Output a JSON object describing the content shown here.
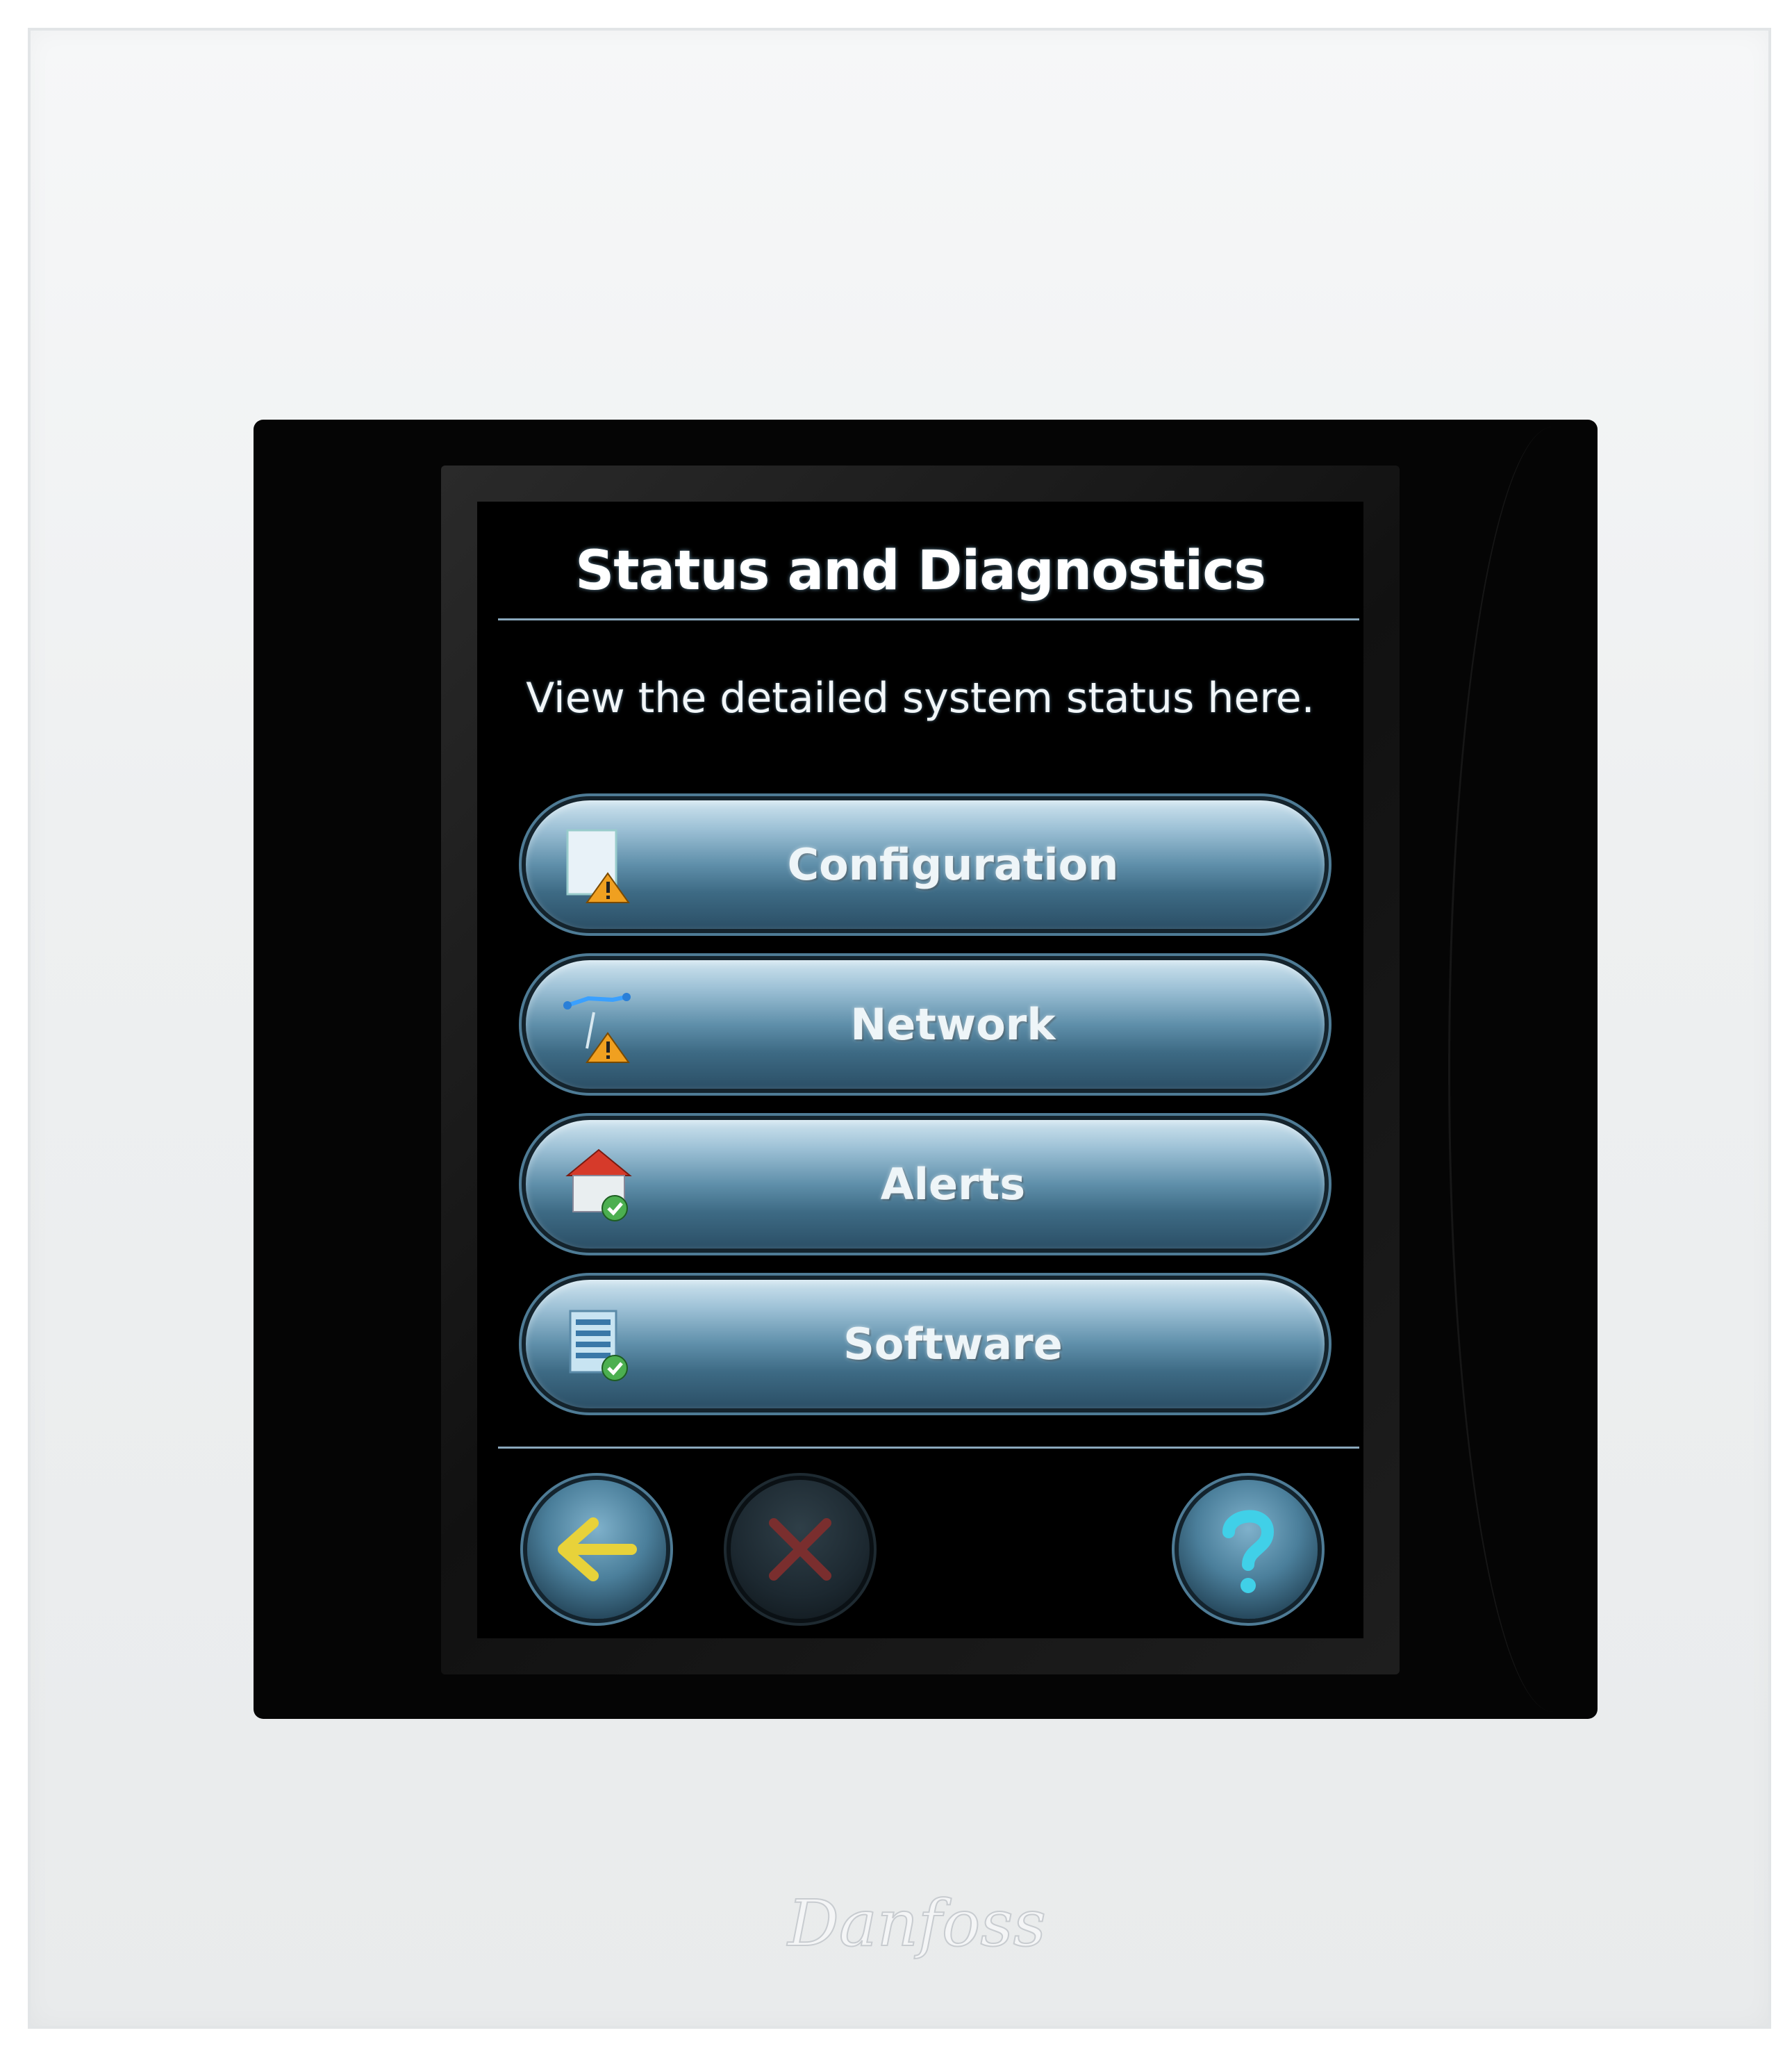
{
  "screen": {
    "title": "Status and Diagnostics",
    "subtitle": "View the detailed system status here."
  },
  "menu": [
    {
      "label": "Configuration",
      "icon": "config-warning-icon",
      "status": "warning"
    },
    {
      "label": "Network",
      "icon": "network-warning-icon",
      "status": "warning"
    },
    {
      "label": "Alerts",
      "icon": "house-ok-icon",
      "status": "ok"
    },
    {
      "label": "Software",
      "icon": "software-ok-icon",
      "status": "ok"
    }
  ],
  "nav": {
    "back_icon": "back-arrow-icon",
    "cancel_icon": "cancel-x-icon",
    "help_icon": "help-question-icon"
  },
  "brand": {
    "logo_text": "Danfoss"
  },
  "colors": {
    "button_blue": "#5f8faa",
    "warning": "#f0a020",
    "ok": "#4caf50",
    "back_arrow": "#e8d23a",
    "cancel_x": "#a33a3a",
    "help_q": "#40d0e8"
  }
}
